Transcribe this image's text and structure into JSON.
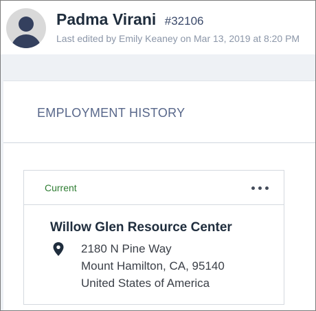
{
  "header": {
    "name": "Padma Virani",
    "record_id": "#32106",
    "edited_text": "Last edited by Emily Keaney on Mar 13, 2019 at 8:20 PM"
  },
  "section": {
    "title": "EMPLOYMENT HISTORY"
  },
  "employment": {
    "status": "Current",
    "employer": "Willow Glen Resource Center",
    "address_line1": "2180 N Pine Way",
    "address_line2": "Mount Hamilton, CA, 95140",
    "address_line3": "United States of America"
  },
  "icons": {
    "avatar": "user-avatar-icon",
    "more": "more-options-icon",
    "location": "map-pin-icon"
  },
  "colors": {
    "status_current": "#2e7d32",
    "name": "#1f2d3d",
    "muted": "#8b96a8",
    "section_title": "#58678a"
  }
}
